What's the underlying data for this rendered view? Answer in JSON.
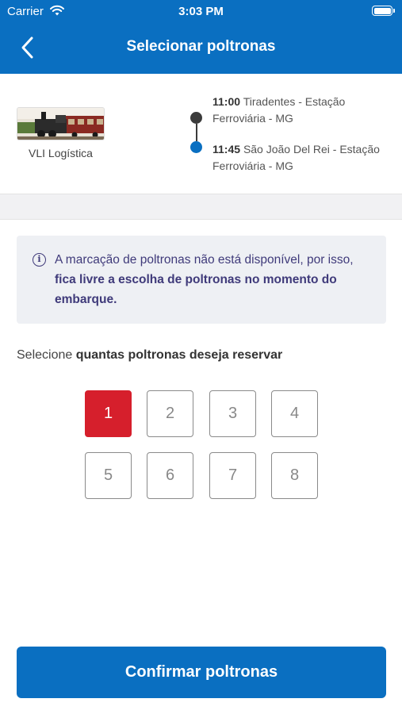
{
  "status_bar": {
    "carrier": "Carrier",
    "time": "3:03 PM"
  },
  "nav": {
    "title": "Selecionar poltronas"
  },
  "trip": {
    "company": "VLI Logística",
    "origin": {
      "time": "11:00",
      "place": "Tiradentes - Estação Ferroviária - MG"
    },
    "destination": {
      "time": "11:45",
      "place": "São João Del Rei - Estação Ferroviária - MG"
    }
  },
  "info": {
    "text_regular": "A marcação de poltronas não está disponível, por isso, ",
    "text_bold": "fica livre a escolha de poltronas no momento do embarque."
  },
  "prompt": {
    "regular": "Selecione ",
    "bold": "quantas poltronas deseja reservar"
  },
  "seats": {
    "options": [
      "1",
      "2",
      "3",
      "4",
      "5",
      "6",
      "7",
      "8"
    ],
    "selected": "1"
  },
  "confirm": {
    "label": "Confirmar poltronas"
  },
  "colors": {
    "primary": "#0a6fc1",
    "selected": "#d61f2c",
    "info_text": "#3f3a7a"
  }
}
